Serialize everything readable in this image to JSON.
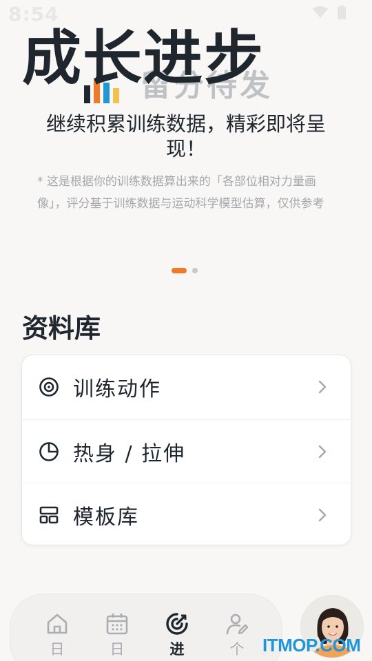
{
  "status_bar": {
    "time": "8:54"
  },
  "hero": {
    "title": "成长进步",
    "ghost_text": "留分待发",
    "subtitle": "继续积累训练数据，精彩即将呈现！",
    "note": "* 这是根据你的训练数据算出来的「各部位相对力量画像」，评分基于训练数据与运动科学模型估算，仅供参考",
    "pager": {
      "count": 2,
      "active_index": 0
    },
    "ghost_bar_colors": [
      "#1f262d",
      "#f07a2a",
      "#2196d6",
      "#f2c14e"
    ]
  },
  "library": {
    "title": "资料库",
    "items": [
      {
        "label": "训练动作",
        "icon": "target-icon"
      },
      {
        "label": "热身 / 拉伸",
        "icon": "pie-chart-icon"
      },
      {
        "label": "模板库",
        "icon": "template-icon"
      }
    ]
  },
  "bottom_nav": {
    "items": [
      {
        "label": "日",
        "icon": "home-icon",
        "active": false
      },
      {
        "label": "日",
        "icon": "calendar-icon",
        "active": false
      },
      {
        "label": "进",
        "icon": "progress-icon",
        "active": true
      },
      {
        "label": "个",
        "icon": "profile-edit-icon",
        "active": false
      }
    ]
  },
  "watermark": "ITMOP.COM",
  "colors": {
    "accent": "#f07a2a",
    "text": "#1f262d",
    "muted": "#a4a8ad",
    "background": "#f8f7f5"
  }
}
